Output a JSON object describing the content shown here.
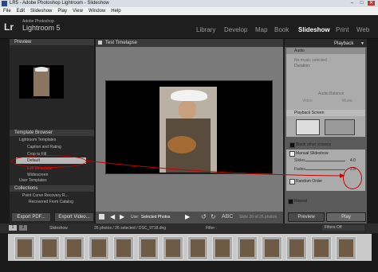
{
  "window": {
    "title": "LR5 - Adobe Photoshop Lightroom - Slideshow",
    "buttons": [
      "–",
      "□",
      "✕"
    ]
  },
  "menu": [
    "File",
    "Edit",
    "Slideshow",
    "Play",
    "View",
    "Window",
    "Help"
  ],
  "app": {
    "logo": "Lr",
    "vendor": "Adobe Photoshop",
    "name": "Lightroom 5"
  },
  "modules": [
    "Library",
    "Develop",
    "Map",
    "Book",
    "Slideshow",
    "Print",
    "Web"
  ],
  "left": {
    "preview_title": "Preview",
    "template_browser": "Template Browser",
    "lightroom_templates": "Lightroom Templates",
    "templates": [
      "Caption and Rating",
      "Crop to Fill",
      "Default",
      "Exif Metadata",
      "Widescreen"
    ],
    "user_templates": "User Templates",
    "collections": "Collections",
    "collection_items": [
      "Point Curve Recovery R...",
      "Recovered From Catalog"
    ],
    "export_pdf": "Export PDF...",
    "export_video": "Export Video..."
  },
  "center": {
    "title": "Test Timelapse",
    "use_label": "Use:",
    "use_value": "Selected Photos",
    "abc": "ABC",
    "slide_info": "Slide 26 of 26 photos"
  },
  "right": {
    "playback_tab": "Playback",
    "audio": "Audio",
    "no_music": "No music selected",
    "duration": "Duration:",
    "audio_balance": "Audio Balance",
    "video": "Video",
    "music": "Music",
    "playback_screen": "Playback Screen",
    "blank_other": "Blank other screens",
    "manual_slideshow": "Manual Slideshow",
    "slides_label": "Slides",
    "slides_value": "4.0",
    "fades_label": "Fades",
    "fades_value": "2.5",
    "random_order": "Random Order",
    "repeat": "Repeat",
    "preview_btn": "Preview",
    "play_btn": "Play"
  },
  "filmstrip": {
    "pages": [
      "1",
      "2"
    ],
    "module": "Slideshow",
    "info": "26 photos / 26 selected / DSC_9718.dng",
    "filter_label": "Filter :",
    "filters_off": "Filters Off",
    "thumb_count": 14
  },
  "colors": {
    "accent": "#c80000",
    "selected": "#e2e2e2",
    "play": "#555555"
  }
}
